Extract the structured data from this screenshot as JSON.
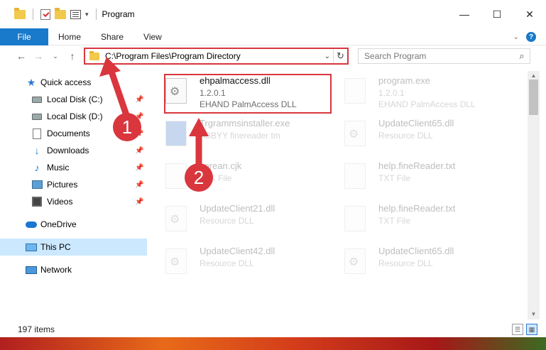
{
  "window": {
    "title": "Program",
    "controls": {
      "minimize": "—",
      "maximize": "☐",
      "close": "✕"
    }
  },
  "ribbon": {
    "file_label": "File",
    "tabs": [
      "Home",
      "Share",
      "View"
    ]
  },
  "address": {
    "path": "C:\\Program Files\\Program Directory",
    "search_placeholder": "Search Program"
  },
  "sidebar": {
    "items": [
      {
        "label": "Quick access",
        "icon": "star-icon",
        "pinned": false
      },
      {
        "label": "Local Disk (C:)",
        "icon": "drive-icon",
        "pinned": true
      },
      {
        "label": "Local Disk (D:)",
        "icon": "drive-icon",
        "pinned": true
      },
      {
        "label": "Documents",
        "icon": "documents-icon",
        "pinned": true
      },
      {
        "label": "Downloads",
        "icon": "downloads-icon",
        "pinned": true
      },
      {
        "label": "Music",
        "icon": "music-icon",
        "pinned": true
      },
      {
        "label": "Pictures",
        "icon": "pictures-icon",
        "pinned": true
      },
      {
        "label": "Videos",
        "icon": "videos-icon",
        "pinned": true
      },
      {
        "label": "OneDrive",
        "icon": "onedrive-icon",
        "pinned": false
      },
      {
        "label": "This PC",
        "icon": "this-pc-icon",
        "pinned": false,
        "selected": true
      },
      {
        "label": "Network",
        "icon": "network-icon",
        "pinned": false
      }
    ]
  },
  "files": [
    {
      "name": "ehpalmaccess.dll",
      "line2": "1.2.0.1",
      "line3": "EHAND PalmAccess  DLL",
      "highlighted": true
    },
    {
      "name": "program.exe",
      "line2": "1.2.0.1",
      "line3": "EHAND PalmAccess  DLL"
    },
    {
      "name": "Trgrammsinstaller.exe",
      "line2": "ABBYY finereader tm",
      "line3": ""
    },
    {
      "name": "UpdateClient65.dll",
      "line2": "Resource DLL",
      "line3": ""
    },
    {
      "name": "korean.cjk",
      "line2": "CJK File",
      "line3": ""
    },
    {
      "name": "help.fineReader.txt",
      "line2": "TXT File",
      "line3": ""
    },
    {
      "name": "UpdateClient21.dll",
      "line2": "Resource DLL",
      "line3": ""
    },
    {
      "name": "help.fineReader.txt",
      "line2": "TXT File",
      "line3": ""
    },
    {
      "name": "UpdateClient42.dll",
      "line2": "Resource DLL",
      "line3": ""
    },
    {
      "name": "UpdateClient65.dll",
      "line2": "Resource DLL",
      "line3": ""
    }
  ],
  "status": {
    "items_count": "197 items"
  },
  "annotations": {
    "step1": "1",
    "step2": "2"
  },
  "colors": {
    "accent": "#1979ca",
    "highlight": "#d9363e",
    "selected_bg": "#cce8ff"
  }
}
